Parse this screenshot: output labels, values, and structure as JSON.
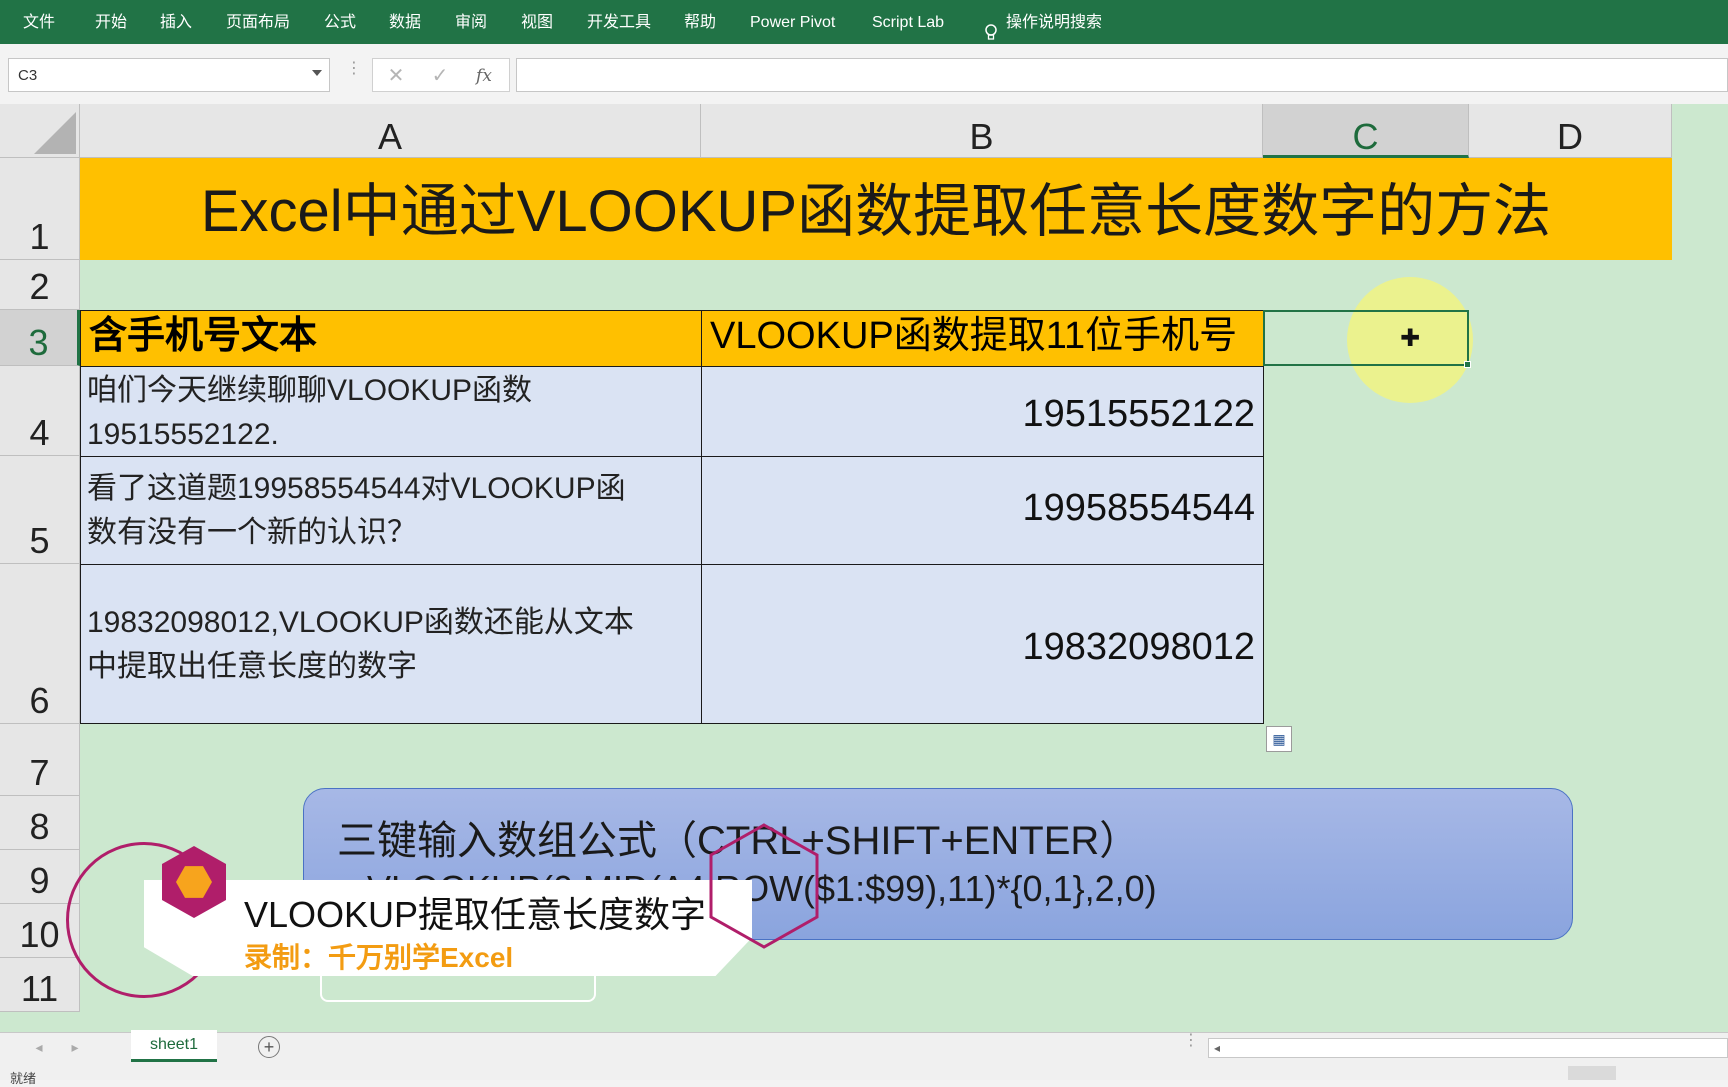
{
  "ribbon": {
    "tabs": [
      "文件",
      "开始",
      "插入",
      "页面布局",
      "公式",
      "数据",
      "审阅",
      "视图",
      "开发工具",
      "帮助",
      "Power Pivot",
      "Script Lab"
    ],
    "search_label": "操作说明搜索"
  },
  "formula_bar": {
    "name_box": "C3",
    "cancel_icon": "✕",
    "enter_icon": "✓",
    "fx_icon": "fx",
    "formula": ""
  },
  "columns": [
    "A",
    "B",
    "C",
    "D"
  ],
  "selected_column": "C",
  "rows": [
    "1",
    "2",
    "3",
    "4",
    "5",
    "6",
    "7",
    "8",
    "9",
    "10",
    "11"
  ],
  "selected_row": "3",
  "sheet": {
    "title": "Excel中通过VLOOKUP函数提取任意长度数字的方法",
    "header_a": "含手机号文本",
    "header_b": "VLOOKUP函数提取11位手机号",
    "data_rows": [
      {
        "text_l1": "咱们今天继续聊聊VLOOKUP函数",
        "text_l2": "19515552122.",
        "number": "19515552122"
      },
      {
        "text_l1": "看了这道题19958554544对VLOOKUP函",
        "text_l2": "数有没有一个新的认识？",
        "number": "19958554544"
      },
      {
        "text_l1": "19832098012,VLOOKUP函数还能从文本",
        "text_l2": "中提取出任意长度的数字",
        "number": "19832098012"
      }
    ]
  },
  "hint": {
    "line1": "三键输入数组公式（CTRL+SHIFT+ENTER）",
    "line2_visible": "-VLOOKUP(0,MID(A4,ROW($1:$99),11)*{0,1},2,0)"
  },
  "overlay": {
    "title": "VLOOKUP提取任意长度数字",
    "subtitle": "录制：千万别学Excel"
  },
  "tabs_bar": {
    "sheet_tab": "sheet1",
    "add_sheet": "+"
  },
  "status": {
    "text": "就绪"
  },
  "colors": {
    "ribbon": "#217346",
    "grid_background": "#cce8cf",
    "header_fill": "#ffc000",
    "data_fill": "#dae3f3",
    "hint_fill": "#8aa4de",
    "overlay_accent": "#b01e6a",
    "overlay_orange": "#f7a41d"
  },
  "icons": {
    "search": "lightbulb-icon",
    "cursor": "cell-select-cursor-icon",
    "quick_analysis": "quick-analysis-icon"
  }
}
